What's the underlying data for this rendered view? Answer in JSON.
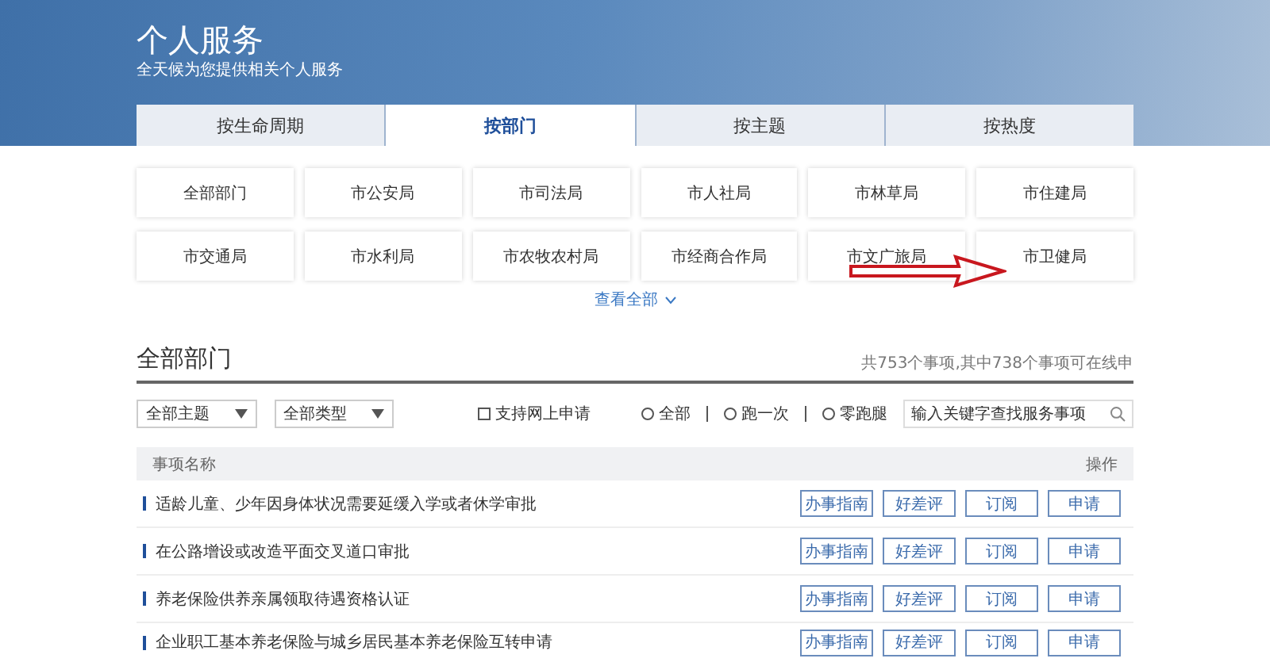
{
  "header": {
    "title": "个人服务",
    "subtitle": "全天候为您提供相关个人服务"
  },
  "tabs": [
    {
      "label": "按生命周期",
      "selected": false
    },
    {
      "label": "按部门",
      "selected": true
    },
    {
      "label": "按主题",
      "selected": false
    },
    {
      "label": "按热度",
      "selected": false
    }
  ],
  "departments": [
    {
      "label": "全部部门"
    },
    {
      "label": "市公安局"
    },
    {
      "label": "市司法局"
    },
    {
      "label": "市人社局"
    },
    {
      "label": "市林草局"
    },
    {
      "label": "市住建局"
    },
    {
      "label": "市交通局"
    },
    {
      "label": "市水利局"
    },
    {
      "label": "市农牧农村局"
    },
    {
      "label": "市经商合作局"
    },
    {
      "label": "市文广旅局"
    },
    {
      "label": "市卫健局"
    }
  ],
  "show_all": "查看全部",
  "section": {
    "title": "全部部门",
    "summary": "共753个事项,其中738个事项可在线申"
  },
  "filters": {
    "dropdowns": [
      {
        "value": "全部主题"
      },
      {
        "value": "全部类型"
      }
    ],
    "online_checkbox": {
      "label": "支持网上申请",
      "checked": false
    },
    "radios": [
      {
        "label": "全部",
        "selected": false
      },
      {
        "label": "跑一次",
        "selected": false
      },
      {
        "label": "零跑腿",
        "selected": false
      }
    ],
    "search": {
      "placeholder": "输入关键字查找服务事项"
    }
  },
  "table": {
    "columns": [
      "事项名称",
      "操作"
    ],
    "rows": [
      {
        "name": "适龄儿童、少年因身体状况需要延缓入学或者休学审批",
        "actions": [
          "办事指南",
          "好差评",
          "订阅",
          "申请"
        ]
      },
      {
        "name": "在公路增设或改造平面交叉道口审批",
        "actions": [
          "办事指南",
          "好差评",
          "订阅",
          "申请"
        ]
      },
      {
        "name": "养老保险供养亲属领取待遇资格认证",
        "actions": [
          "办事指南",
          "好差评",
          "订阅",
          "申请"
        ]
      },
      {
        "name": "企业职工基本养老保险与城乡居民基本养老保险互转申请",
        "actions": [
          "办事指南",
          "好差评",
          "订阅",
          "申请"
        ]
      }
    ]
  }
}
